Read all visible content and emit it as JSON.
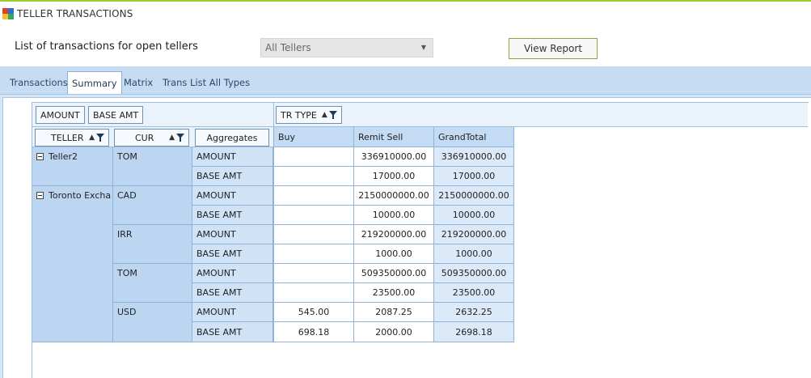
{
  "window": {
    "title": "TELLER TRANSACTIONS"
  },
  "header": {
    "label": "List of transactions for open tellers",
    "teller_select": {
      "value": "All Tellers"
    },
    "view_report_label": "View Report"
  },
  "tabs": [
    {
      "label": "Transactions",
      "active": false
    },
    {
      "label": "Summary",
      "active": true
    },
    {
      "label": "Matrix",
      "active": false
    },
    {
      "label": "Trans List All Types",
      "active": false
    }
  ],
  "pivot": {
    "data_fields": [
      "AMOUNT",
      "BASE AMT"
    ],
    "column_field": "TR TYPE",
    "row_fields": [
      "TELLER",
      "CUR"
    ],
    "aggregates_label": "Aggregates",
    "columns": [
      "Buy",
      "Remit Sell",
      "GrandTotal"
    ],
    "groups": [
      {
        "teller": "Teller2",
        "currencies": [
          {
            "cur": "TOM",
            "rows": [
              {
                "agg": "AMOUNT",
                "buy": "",
                "remit_sell": "336910000.00",
                "grand_total": "336910000.00"
              },
              {
                "agg": "BASE AMT",
                "buy": "",
                "remit_sell": "17000.00",
                "grand_total": "17000.00"
              }
            ]
          }
        ]
      },
      {
        "teller": "Toronto Excha",
        "currencies": [
          {
            "cur": "CAD",
            "rows": [
              {
                "agg": "AMOUNT",
                "buy": "",
                "remit_sell": "2150000000.00",
                "grand_total": "2150000000.00"
              },
              {
                "agg": "BASE AMT",
                "buy": "",
                "remit_sell": "10000.00",
                "grand_total": "10000.00"
              }
            ]
          },
          {
            "cur": "IRR",
            "rows": [
              {
                "agg": "AMOUNT",
                "buy": "",
                "remit_sell": "219200000.00",
                "grand_total": "219200000.00"
              },
              {
                "agg": "BASE AMT",
                "buy": "",
                "remit_sell": "1000.00",
                "grand_total": "1000.00"
              }
            ]
          },
          {
            "cur": "TOM",
            "rows": [
              {
                "agg": "AMOUNT",
                "buy": "",
                "remit_sell": "509350000.00",
                "grand_total": "509350000.00"
              },
              {
                "agg": "BASE AMT",
                "buy": "",
                "remit_sell": "23500.00",
                "grand_total": "23500.00"
              }
            ]
          },
          {
            "cur": "USD",
            "rows": [
              {
                "agg": "AMOUNT",
                "buy": "545.00",
                "remit_sell": "2087.25",
                "grand_total": "2632.25"
              },
              {
                "agg": "BASE AMT",
                "buy": "698.18",
                "remit_sell": "2000.00",
                "grand_total": "2698.18"
              }
            ]
          }
        ]
      }
    ]
  }
}
